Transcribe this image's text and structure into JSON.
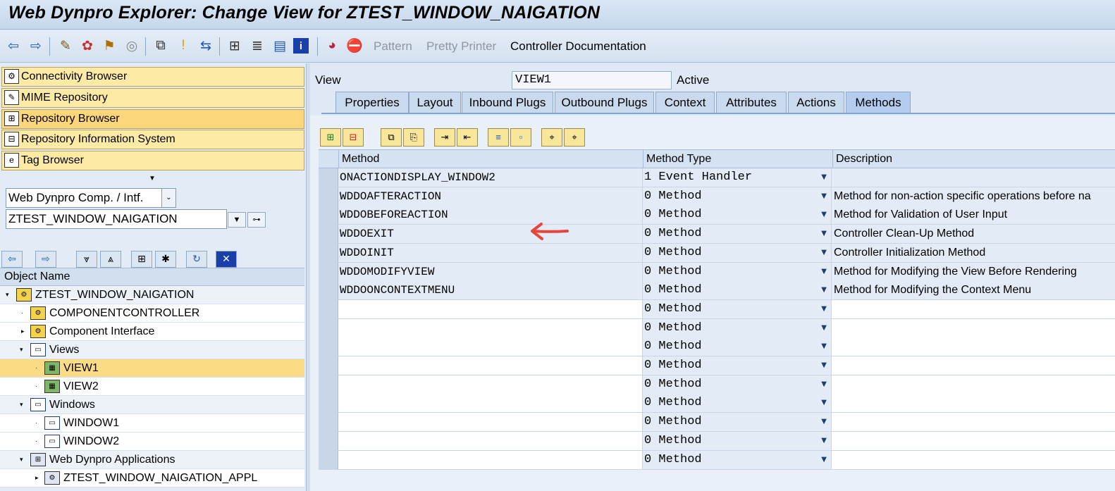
{
  "window": {
    "title": "Web Dynpro Explorer: Change View for ZTEST_WINDOW_NAIGATION"
  },
  "toolbar": {
    "icons": [
      "back-arrow-icon",
      "forward-arrow-icon",
      "pencil-glasses-icon",
      "other-object-icon",
      "activate-icon",
      "spiral-icon",
      "hierarchy-icon",
      "lightbulb-icon",
      "where-used-icon",
      "tree-icon",
      "stack-icon",
      "list-icon",
      "info-icon",
      "pie-icon",
      "stop-icon"
    ],
    "pattern": "Pattern",
    "pretty_printer": "Pretty Printer",
    "controller_documentation": "Controller Documentation"
  },
  "nav": {
    "items": [
      {
        "label": "Connectivity Browser",
        "icon": "connectivity-icon"
      },
      {
        "label": "MIME Repository",
        "icon": "mime-icon"
      },
      {
        "label": "Repository Browser",
        "icon": "repository-icon",
        "active": true
      },
      {
        "label": "Repository Information System",
        "icon": "info-system-icon"
      },
      {
        "label": "Tag Browser",
        "icon": "tag-icon"
      }
    ]
  },
  "object_type": {
    "value": "Web Dynpro Comp. / Intf."
  },
  "object_name": {
    "value": "ZTEST_WINDOW_NAIGATION"
  },
  "tree": {
    "header": "Object Name",
    "rows": [
      {
        "label": "ZTEST_WINDOW_NAIGATION",
        "level": 0,
        "expander": "▾",
        "icon": "component-icon",
        "group": true
      },
      {
        "label": "COMPONENTCONTROLLER",
        "level": 1,
        "expander": "·",
        "icon": "controller-icon"
      },
      {
        "label": "Component Interface",
        "level": 1,
        "expander": "▸",
        "icon": "interface-icon"
      },
      {
        "label": "Views",
        "level": 1,
        "expander": "▾",
        "icon": "views-folder-icon",
        "group": true
      },
      {
        "label": "VIEW1",
        "level": 2,
        "expander": "·",
        "icon": "view-icon",
        "selected": true
      },
      {
        "label": "VIEW2",
        "level": 2,
        "expander": "·",
        "icon": "view-icon"
      },
      {
        "label": "Windows",
        "level": 1,
        "expander": "▾",
        "icon": "windows-folder-icon",
        "group": true
      },
      {
        "label": "WINDOW1",
        "level": 2,
        "expander": "·",
        "icon": "window-icon"
      },
      {
        "label": "WINDOW2",
        "level": 2,
        "expander": "·",
        "icon": "window-icon"
      },
      {
        "label": "Web Dynpro Applications",
        "level": 1,
        "expander": "▾",
        "icon": "applications-icon",
        "group": true
      },
      {
        "label": "ZTEST_WINDOW_NAIGATION_APPL",
        "level": 2,
        "expander": "▸",
        "icon": "application-icon"
      }
    ]
  },
  "view": {
    "label": "View",
    "name": "VIEW1",
    "status": "Active"
  },
  "tabs": [
    {
      "label": "Properties"
    },
    {
      "label": "Layout"
    },
    {
      "label": "Inbound Plugs"
    },
    {
      "label": "Outbound Plugs"
    },
    {
      "label": "Context"
    },
    {
      "label": "Attributes"
    },
    {
      "label": "Actions"
    },
    {
      "label": "Methods",
      "active": true
    }
  ],
  "methods_table": {
    "columns": [
      "Method",
      "Method Type",
      "Description"
    ],
    "rows": [
      {
        "method": "ONACTIONDISPLAY_WINDOW2",
        "type": "1 Event Handler",
        "description": ""
      },
      {
        "method": "WDDOAFTERACTION",
        "type": "0 Method",
        "description": "Method for non-action specific operations before na"
      },
      {
        "method": "WDDOBEFOREACTION",
        "type": "0 Method",
        "description": "Method for Validation of User Input"
      },
      {
        "method": "WDDOEXIT",
        "type": "0 Method",
        "description": "Controller Clean-Up Method"
      },
      {
        "method": "WDDOINIT",
        "type": "0 Method",
        "description": "Controller Initialization Method"
      },
      {
        "method": "WDDOMODIFYVIEW",
        "type": "0 Method",
        "description": "Method for Modifying the View Before Rendering"
      },
      {
        "method": "WDDOONCONTEXTMENU",
        "type": "0 Method",
        "description": "Method for Modifying the Context Menu"
      },
      {
        "method": "",
        "type": "0 Method",
        "description": ""
      },
      {
        "method": "",
        "type": "0 Method",
        "description": ""
      },
      {
        "method": "",
        "type": "0 Method",
        "description": ""
      },
      {
        "method": "",
        "type": "0 Method",
        "description": ""
      },
      {
        "method": "",
        "type": "0 Method",
        "description": ""
      },
      {
        "method": "",
        "type": "0 Method",
        "description": ""
      },
      {
        "method": "",
        "type": "0 Method",
        "description": ""
      },
      {
        "method": "",
        "type": "0 Method",
        "description": ""
      },
      {
        "method": "",
        "type": "0 Method",
        "description": ""
      }
    ]
  },
  "colors": {
    "annotation_arrow": "#e8443a",
    "nav_button": "#fdeaa4",
    "selected_row": "#fbdc85"
  }
}
